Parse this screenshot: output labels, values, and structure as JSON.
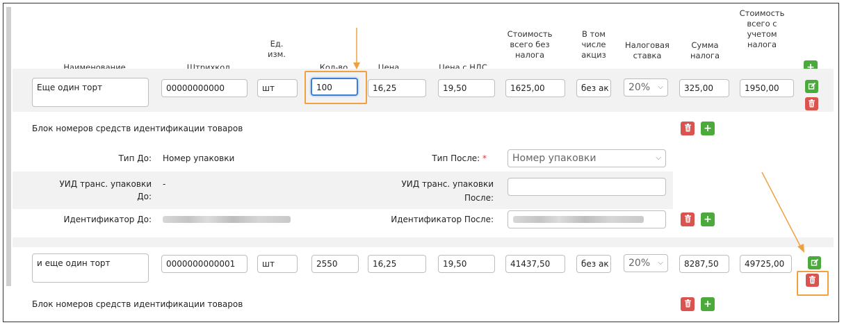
{
  "headers": {
    "name": "Наименование",
    "barcode": "Штрихкод",
    "unit": "Ед.\nизм.",
    "qty": "Кол-во",
    "price": "Цена",
    "price_vat": "Цена с НДС",
    "cost_no_tax": "Стоимость\nвсего без\nналога",
    "excise": "В том\nчисле\nакциз",
    "tax_rate": "Налоговая\nставка",
    "tax_sum": "Сумма\nналога",
    "cost_with_tax": "Стоимость\nвсего с\nучетом\nналога"
  },
  "rows": [
    {
      "name": "Еще один торт",
      "barcode": "00000000000",
      "unit": "шт",
      "qty": "100",
      "price": "16,25",
      "price_vat": "19,50",
      "cost_no_tax": "1625,00",
      "excise": "без ак",
      "tax_rate": "20%",
      "tax_sum": "325,00",
      "cost_with_tax": "1950,00"
    },
    {
      "name": "и еще один торт",
      "barcode": "0000000000001",
      "unit": "шт",
      "qty": "2550",
      "price": "16,25",
      "price_vat": "19,50",
      "cost_no_tax": "41437,50",
      "excise": "без ак",
      "tax_rate": "20%",
      "tax_sum": "8287,50",
      "cost_with_tax": "49725,00"
    }
  ],
  "ident_block": {
    "title": "Блок номеров средств идентификации товаров",
    "type_before_label": "Тип До:",
    "type_before_value": "Номер упаковки",
    "type_after_label": "Тип После:",
    "required_mark": "*",
    "type_after_value": "Номер упаковки",
    "uid_before_label_1": "УИД транс. упаковки",
    "uid_before_label_2": "До:",
    "uid_before_value": "-",
    "uid_after_label_1": "УИД транс. упаковки",
    "uid_after_label_2": "После:",
    "id_before_label": "Идентификатор До:",
    "id_after_label": "Идентификатор После:"
  },
  "icons": {
    "add": "+"
  },
  "colors": {
    "green": "#4caa3c",
    "red": "#d9534f",
    "highlight": "#f0a040",
    "focus": "#3d7fd6"
  }
}
